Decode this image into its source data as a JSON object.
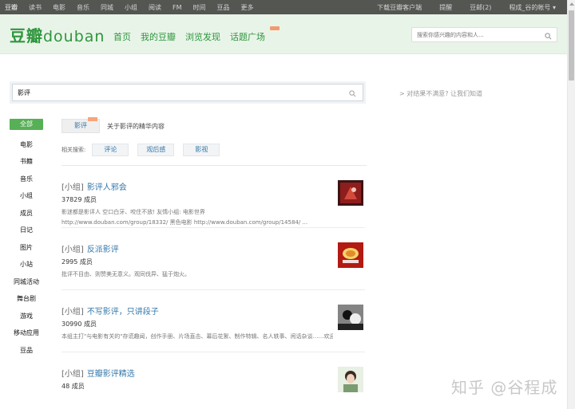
{
  "topbar": {
    "left_items": [
      "豆瓣",
      "读书",
      "电影",
      "音乐",
      "同城",
      "小组",
      "阅读",
      "FM",
      "时间",
      "豆品",
      "更多"
    ],
    "right_items": [
      "下载豆瓣客户端",
      "提醒",
      "豆邮(2)",
      "程成_谷的帐号 ▾"
    ]
  },
  "header": {
    "logo_cn": "豆瓣",
    "logo_en": "douban",
    "nav": [
      "首页",
      "我的豆瓣",
      "浏览发现",
      "话题广场"
    ],
    "search_placeholder": "搜索你感兴趣的内容和人..."
  },
  "search": {
    "value": "影评",
    "side_note": "> 对结果不满意? 让我们知道"
  },
  "categories": [
    "全部",
    "电影",
    "书籍",
    "音乐",
    "小组",
    "成员",
    "日记",
    "图片",
    "小站",
    "同城活动",
    "舞台剧",
    "游戏",
    "移动应用",
    "豆品"
  ],
  "tab": {
    "label": "影评",
    "description": "关于影评的精华内容"
  },
  "related": {
    "label": "相关搜索:",
    "chips": [
      "评论",
      "观后感",
      "影视"
    ]
  },
  "results": [
    {
      "tag": "[小组]",
      "name": "影评人邪会",
      "members": "37829 成员",
      "desc1": "影迷都是影评人 空口白牙、咬住不放! 友情小组: 电影世界",
      "desc2": "http://www.douban.com/group/18332/ 黑色电影 http://www.douban.com/group/14584/ ..."
    },
    {
      "tag": "[小组]",
      "name": "反派影评",
      "members": "2995 成员",
      "desc1": "批评不目由、则赞美无意义。观同伐异、猛于炮火。",
      "desc2": ""
    },
    {
      "tag": "[小组]",
      "name": "不写影评，只讲段子",
      "members": "30990 成员",
      "desc1": "本组主打\"与电影有关的\"存谎趣闻，创作手册、片场直击、幕后花絮、制作特辑、名人轶事、闲话杂谈……欢迎各位碎嘴子们各抒己见，畅所欲言,但请勿发布与小组讨论主题无...",
      "desc2": ""
    },
    {
      "tag": "[小组]",
      "name": "豆瓣影评精选",
      "members": "48 成员",
      "desc1": "",
      "desc2": ""
    }
  ],
  "watermark": "知乎 @谷程成",
  "colors": {
    "brand_green": "#2e963d",
    "link_blue": "#3377aa",
    "active_green": "#57b055"
  }
}
